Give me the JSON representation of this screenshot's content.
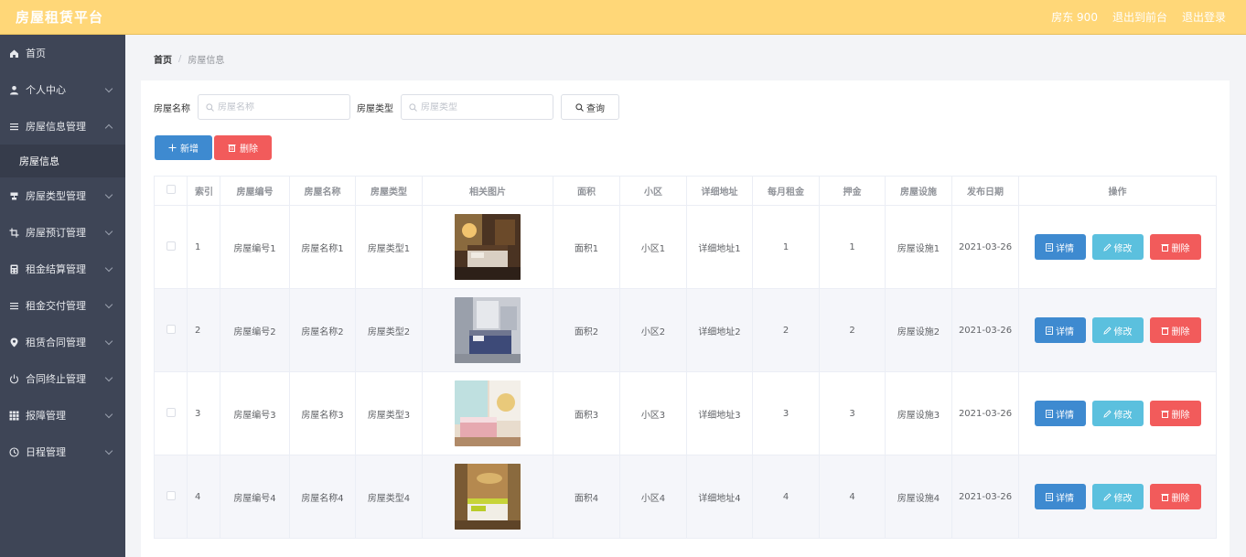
{
  "header": {
    "title": "房屋租赁平台",
    "user": "房东 900",
    "back_front": "退出到前台",
    "logout": "退出登录"
  },
  "sidebar": {
    "items": [
      {
        "label": "首页",
        "icon": "home-icon"
      },
      {
        "label": "个人中心",
        "icon": "user-icon"
      },
      {
        "label": "房屋信息管理",
        "icon": "list-icon"
      },
      {
        "label": "房屋信息"
      },
      {
        "label": "房屋类型管理",
        "icon": "cup-icon"
      },
      {
        "label": "房屋预订管理",
        "icon": "crop-icon"
      },
      {
        "label": "租金结算管理",
        "icon": "calc-icon"
      },
      {
        "label": "租金交付管理",
        "icon": "list-icon"
      },
      {
        "label": "租赁合同管理",
        "icon": "pin-icon"
      },
      {
        "label": "合同终止管理",
        "icon": "power-icon"
      },
      {
        "label": "报障管理",
        "icon": "grid-icon"
      },
      {
        "label": "日程管理",
        "icon": "clock-icon"
      }
    ]
  },
  "breadcrumb": {
    "home": "首页",
    "sep": "/",
    "current": "房屋信息"
  },
  "search": {
    "name_label": "房屋名称",
    "name_placeholder": "房屋名称",
    "type_label": "房屋类型",
    "type_placeholder": "房屋类型",
    "query_label": "查询"
  },
  "actions": {
    "add": "新增",
    "delete": "删除"
  },
  "table": {
    "headers": [
      "",
      "索引",
      "房屋编号",
      "房屋名称",
      "房屋类型",
      "相关图片",
      "面积",
      "小区",
      "详细地址",
      "每月租金",
      "押金",
      "房屋设施",
      "发布日期",
      "操作"
    ],
    "rows": [
      {
        "index": "1",
        "code": "房屋编号1",
        "name": "房屋名称1",
        "type": "房屋类型1",
        "area": "面积1",
        "community": "小区1",
        "address": "详细地址1",
        "rent": "1",
        "deposit": "1",
        "facility": "房屋设施1",
        "date": "2021-03-26"
      },
      {
        "index": "2",
        "code": "房屋编号2",
        "name": "房屋名称2",
        "type": "房屋类型2",
        "area": "面积2",
        "community": "小区2",
        "address": "详细地址2",
        "rent": "2",
        "deposit": "2",
        "facility": "房屋设施2",
        "date": "2021-03-26"
      },
      {
        "index": "3",
        "code": "房屋编号3",
        "name": "房屋名称3",
        "type": "房屋类型3",
        "area": "面积3",
        "community": "小区3",
        "address": "详细地址3",
        "rent": "3",
        "deposit": "3",
        "facility": "房屋设施3",
        "date": "2021-03-26"
      },
      {
        "index": "4",
        "code": "房屋编号4",
        "name": "房屋名称4",
        "type": "房屋类型4",
        "area": "面积4",
        "community": "小区4",
        "address": "详细地址4",
        "rent": "4",
        "deposit": "4",
        "facility": "房屋设施4",
        "date": "2021-03-26"
      }
    ],
    "op_detail": "详情",
    "op_edit": "修改",
    "op_delete": "删除"
  },
  "colors": {
    "header": "#ffd778",
    "sidebar": "#3e4556",
    "primary": "#3e8ad0",
    "info": "#5bc0de",
    "danger": "#f25b5b"
  }
}
